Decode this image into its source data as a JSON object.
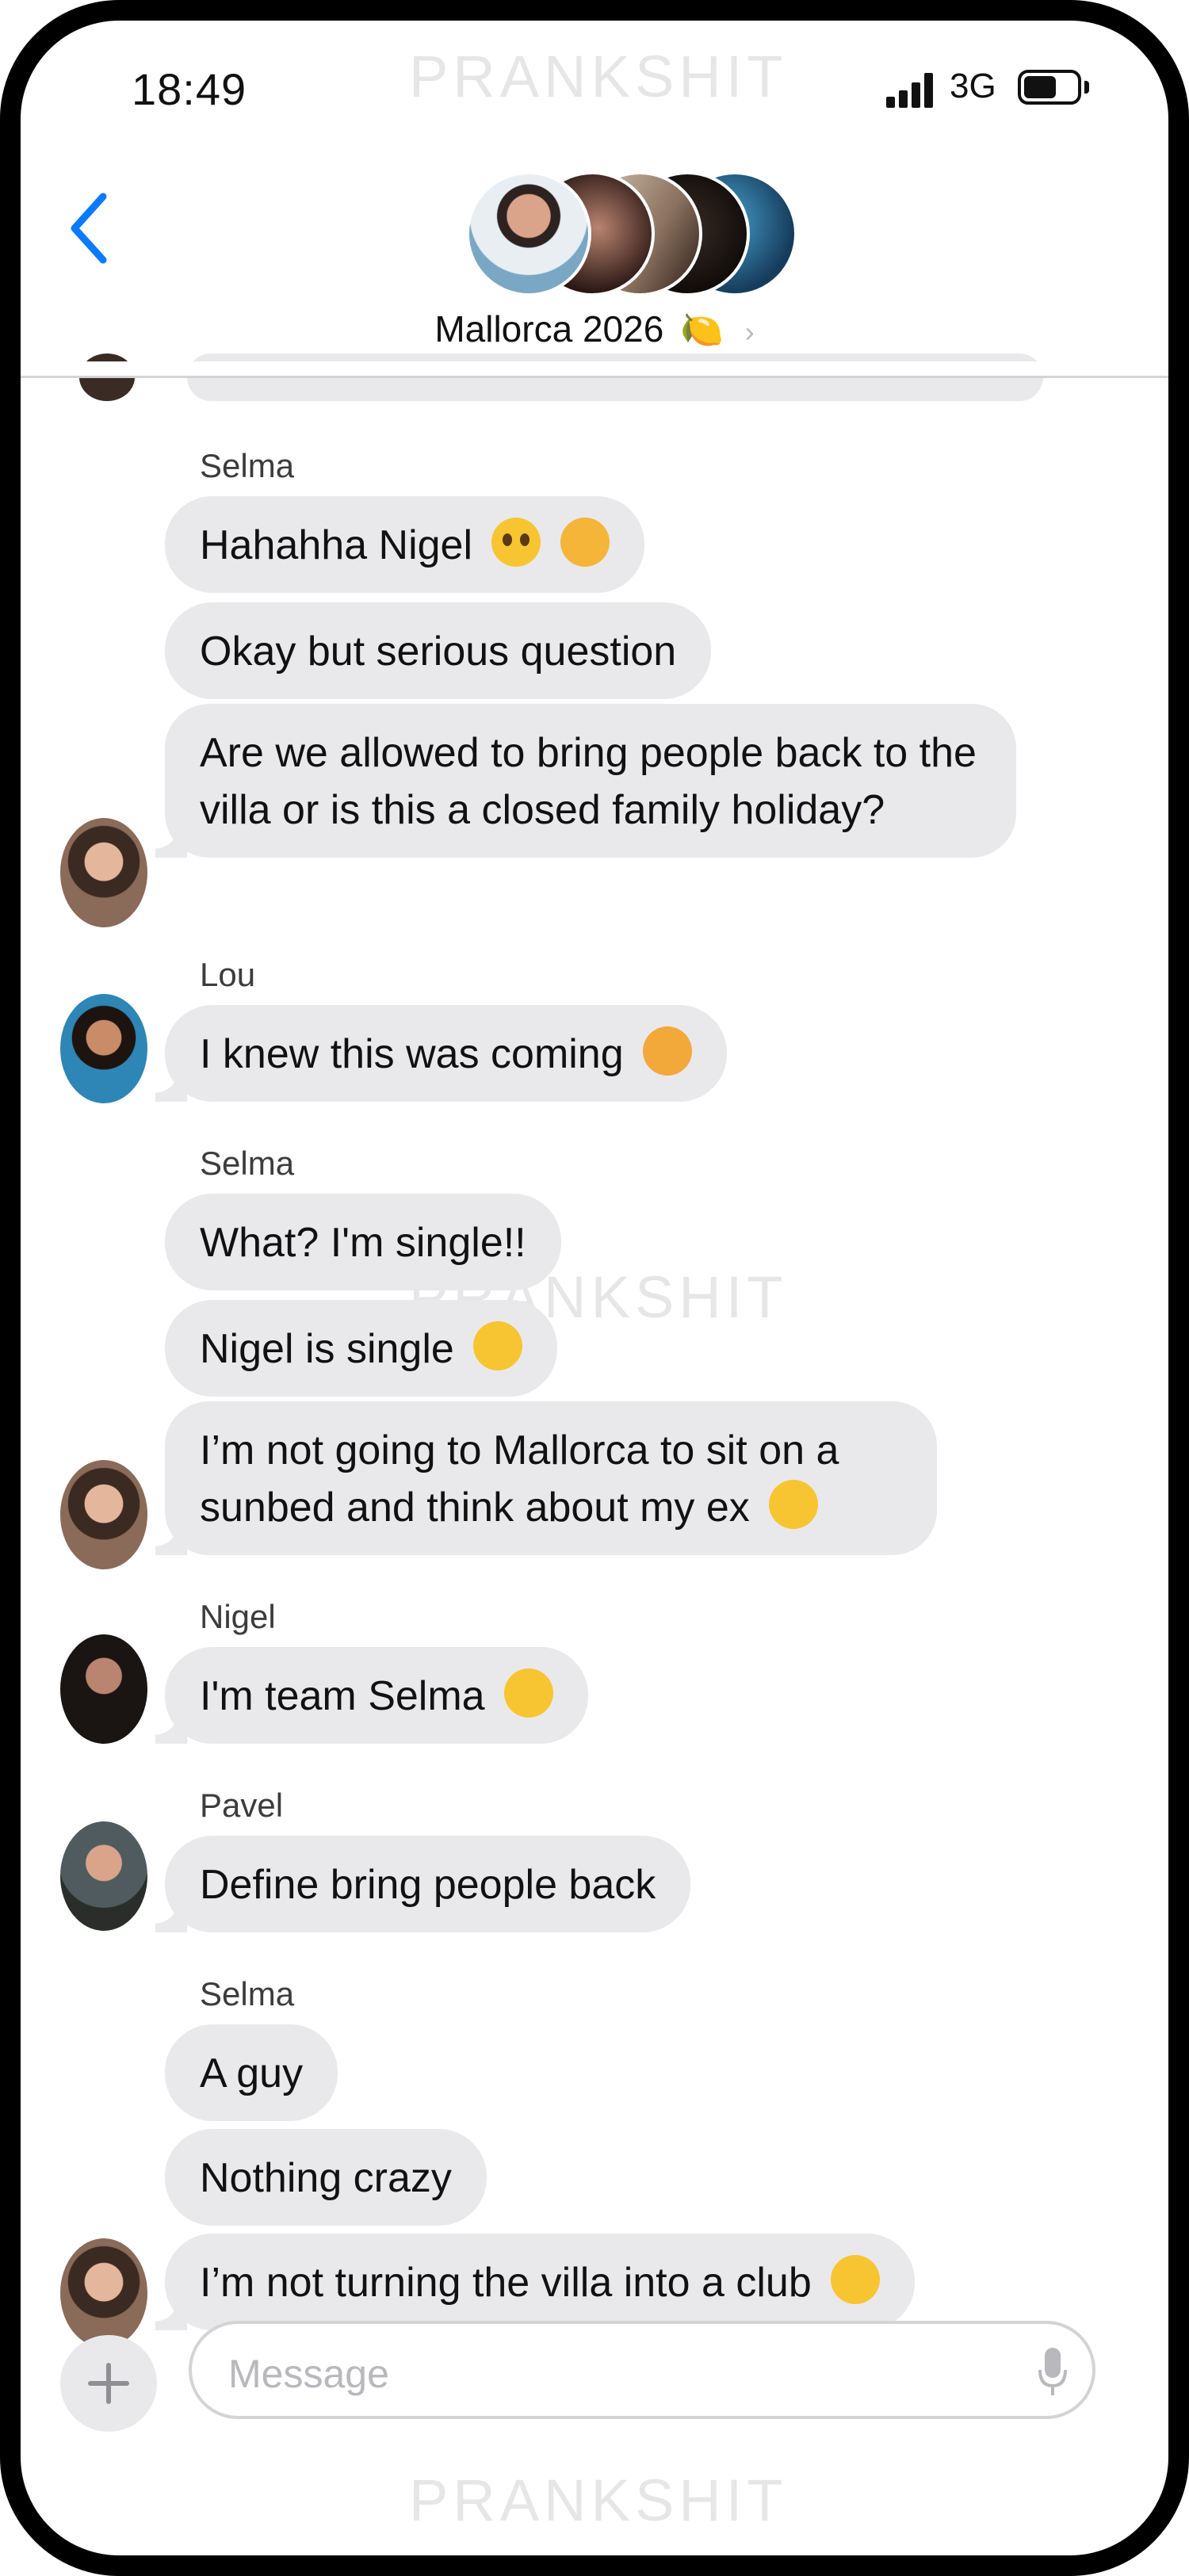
{
  "status_bar": {
    "time": "18:49",
    "network": "3G"
  },
  "watermark": "PRANKSHIT",
  "header": {
    "group_name": "Mallorca 2026",
    "group_emoji": "🍋",
    "chevron": "›"
  },
  "icons": {
    "back": "chevron-left-icon",
    "plus": "plus-icon",
    "mic": "microphone-icon"
  },
  "colors": {
    "accent": "#0a7aff",
    "bubble": "#e9e9eb",
    "text": "#111111"
  },
  "messages": {
    "s1_sender": "Selma",
    "m1": "Hahahha Nigel",
    "m2": "Okay but serious question",
    "m3": "Are we allowed to bring people back to the villa or is this a closed family holiday?",
    "s2_sender": "Lou",
    "m4": "I knew this was coming",
    "s3_sender": "Selma",
    "m5": "What? I'm single!!",
    "m6": "Nigel is single",
    "m7": "I’m not going to Mallorca to sit on a sunbed and think about my ex",
    "s4_sender": "Nigel",
    "m8": "I'm team Selma",
    "s5_sender": "Pavel",
    "m9": "Define bring people back",
    "s6_sender": "Selma",
    "m10": "A guy",
    "m11": "Nothing crazy",
    "m12": "I’m not turning the villa into a club"
  },
  "composer": {
    "placeholder": "Message"
  }
}
